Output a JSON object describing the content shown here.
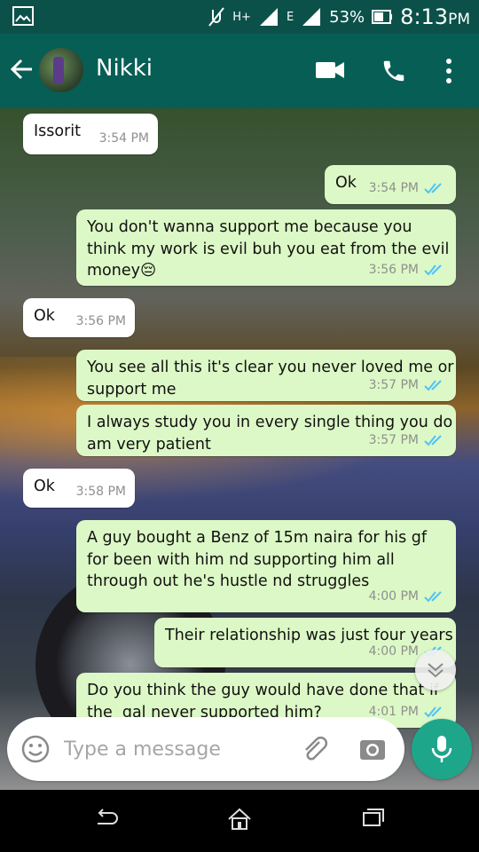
{
  "status_bar": {
    "network_h": "H+",
    "network_e": "E",
    "battery": "53%",
    "time": "8:13",
    "ampm": "PM"
  },
  "header": {
    "contact_name": "Nikki"
  },
  "messages": [
    {
      "dir": "in",
      "text": "Issorit",
      "time": "3:54 PM"
    },
    {
      "dir": "out",
      "text": "Ok",
      "time": "3:54 PM"
    },
    {
      "dir": "out",
      "text": "You don't wanna support me because you\nthink my work is evil buh you eat from the evil\nmoney😔",
      "time": "3:56 PM"
    },
    {
      "dir": "in",
      "text": "Ok",
      "time": "3:56 PM"
    },
    {
      "dir": "out",
      "text": "You see all this it's clear you never loved me or\nsupport me",
      "time": "3:57 PM"
    },
    {
      "dir": "out",
      "text": "I always study you in every single thing you do\nam very patient",
      "time": "3:57 PM"
    },
    {
      "dir": "in",
      "text": "Ok",
      "time": "3:58 PM"
    },
    {
      "dir": "out",
      "text": "A guy bought a Benz of 15m naira for his gf\nfor been with him nd supporting him all\nthrough out he's hustle nd struggles",
      "time": "4:00 PM"
    },
    {
      "dir": "out",
      "text": "Their relationship was just four years",
      "time": "4:00 PM"
    },
    {
      "dir": "out",
      "text": "Do you think the guy would have done that if\nthe  gal never supported him?",
      "time": "4:01 PM"
    }
  ],
  "composer": {
    "placeholder": "Type a message"
  },
  "colors": {
    "header": "#075e54",
    "status_bar": "#0b5149",
    "outgoing_bubble": "#dcf8c6",
    "incoming_bubble": "#ffffff",
    "mic_button": "#1ea68b",
    "read_tick": "#4fc3f7"
  },
  "icons": {
    "back": "arrow-left-icon",
    "video": "video-camera-icon",
    "call": "phone-icon",
    "menu": "more-vertical-icon",
    "emoji": "smiley-icon",
    "attach": "paperclip-icon",
    "camera": "camera-icon",
    "mic": "microphone-icon",
    "scroll": "chevron-double-down-icon"
  }
}
